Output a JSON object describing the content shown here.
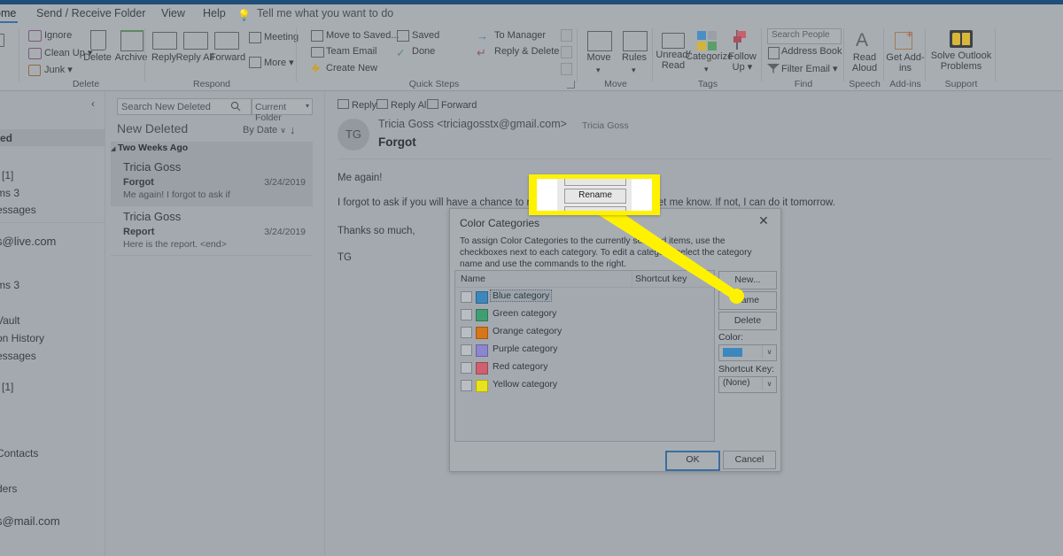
{
  "window": {
    "accent_color": "#1f4e79",
    "chrome_color": "#a8adb2"
  },
  "tabs": [
    {
      "label": "ome",
      "active": true
    },
    {
      "label": "Send / Receive",
      "active": false
    },
    {
      "label": "Folder",
      "active": false
    },
    {
      "label": "View",
      "active": false
    },
    {
      "label": "Help",
      "active": false
    }
  ],
  "tell_me": {
    "label": "Tell me what you want to do",
    "icon": "lightbulb-icon"
  },
  "ribbon": {
    "groups": [
      {
        "name": "Delete",
        "label": "Delete",
        "small_commands": [
          "Ignore",
          "Clean Up ▾",
          "Junk  ▾"
        ],
        "big_commands": [
          "Delete",
          "Archive"
        ]
      },
      {
        "name": "Respond",
        "label": "Respond",
        "small_commands": [
          "Meeting",
          "More ▾"
        ],
        "big_commands": [
          "Reply",
          "Reply All",
          "Forward"
        ]
      },
      {
        "name": "QuickSteps",
        "label": "Quick Steps",
        "small_commands": [
          "Move to Saved...",
          "Team Email",
          "Create New",
          "Saved",
          "Done",
          "To Manager",
          "Reply & Delete"
        ],
        "big_commands": []
      },
      {
        "name": "Move",
        "label": "Move",
        "small_commands": [],
        "big_commands": [
          "Move",
          "Rules"
        ]
      },
      {
        "name": "Tags",
        "label": "Tags",
        "small_commands": [],
        "big_commands": [
          "Unread/ Read",
          "Categorize",
          "Follow Up ▾"
        ]
      },
      {
        "name": "Find",
        "label": "Find",
        "small_commands": [
          "Address Book",
          "Filter Email ▾"
        ],
        "big_commands": [],
        "search_placeholder": "Search People"
      },
      {
        "name": "Speech",
        "label": "Speech",
        "small_commands": [],
        "big_commands": [
          "Read Aloud"
        ]
      },
      {
        "name": "AddIns",
        "label": "Add-ins",
        "small_commands": [],
        "big_commands": [
          "Get Add-ins"
        ]
      },
      {
        "name": "Support",
        "label": "Support",
        "small_commands": [],
        "big_commands": [
          "Solve Outlook Problems"
        ]
      }
    ]
  },
  "left_nav": {
    "collapse_icon": "chevron-left-icon",
    "items": [
      {
        "label": "ted",
        "selected": true
      },
      {
        "label": "[1]",
        "selected": false
      },
      {
        "label": "ms 3",
        "selected": false
      },
      {
        "label": "essages",
        "selected": false
      },
      {
        "label": "s@live.com",
        "selected": false
      },
      {
        "label": "ms 3",
        "selected": false
      },
      {
        "label": "Vault",
        "selected": false
      },
      {
        "label": "on History",
        "selected": false
      },
      {
        "label": "essages",
        "selected": false
      },
      {
        "label": "[1]",
        "selected": false
      },
      {
        "label": "Contacts",
        "selected": false
      },
      {
        "label": "ders",
        "selected": false
      },
      {
        "label": "s@mail.com",
        "selected": false
      }
    ]
  },
  "message_list": {
    "search_placeholder": "Search New Deleted",
    "search_icon": "search-icon",
    "scope_label": "Current Folder",
    "scope_arrow": "▾",
    "folder_title": "New Deleted",
    "sort_label": "By Date",
    "sort_chevron": "∨",
    "sort_direction_icon": "↓",
    "group_header": "Two Weeks Ago",
    "group_triangle": "◢",
    "messages": [
      {
        "from": "Tricia Goss",
        "subject": "Forgot",
        "preview": "Me again!  I forgot to ask if",
        "date": "3/24/2019",
        "selected": true
      },
      {
        "from": "Tricia Goss",
        "subject": "Report",
        "preview": "Here is the report. <end>",
        "date": "3/24/2019",
        "selected": false
      }
    ]
  },
  "reading_pane": {
    "actions": [
      "Reply",
      "Reply All",
      "Forward"
    ],
    "avatar_initials": "TG",
    "from_line": "Tricia Goss  <triciagosstx@gmail.com>",
    "to_name": "Tricia Goss",
    "subject": "Forgot",
    "body": [
      "Me again!",
      "I forgot to ask if you will have a chance to run                                marketing items. Please let me know. If not, I can do it tomorrow.",
      "Thanks so much,",
      "TG"
    ]
  },
  "callout": {
    "button_label": "Rename",
    "highlight_color": "#fff200"
  },
  "dialog": {
    "title": "Color Categories",
    "close_icon": "close-icon",
    "description": "To assign Color Categories to the currently selected items, use the checkboxes next to each category.  To edit a category, select the category name and use the commands to the right.",
    "list_headers": [
      "Name",
      "Shortcut key"
    ],
    "categories": [
      {
        "name": "Blue category",
        "color": "#3d87bd",
        "checked": false,
        "selected": true
      },
      {
        "name": "Green category",
        "color": "#3f9f73",
        "checked": false,
        "selected": false
      },
      {
        "name": "Orange category",
        "color": "#d6761b",
        "checked": false,
        "selected": false
      },
      {
        "name": "Purple category",
        "color": "#8c85cf",
        "checked": false,
        "selected": false
      },
      {
        "name": "Red category",
        "color": "#cf6070",
        "checked": false,
        "selected": false
      },
      {
        "name": "Yellow category",
        "color": "#e8e21f",
        "checked": false,
        "selected": false
      }
    ],
    "buttons": {
      "new": "New...",
      "rename": "name",
      "delete": "Delete",
      "ok": "OK",
      "cancel": "Cancel"
    },
    "color_label": "Color:",
    "color_value": "#3d87bd",
    "shortcut_label": "Shortcut Key:",
    "shortcut_value": "(None)",
    "combo_arrow": "∨"
  }
}
